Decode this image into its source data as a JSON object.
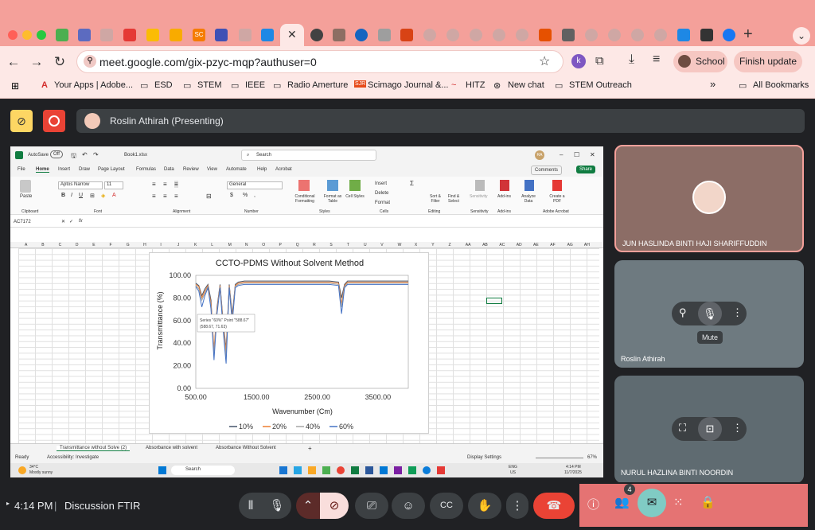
{
  "browser": {
    "url": "meet.google.com/gix-pzyc-mqp?authuser=0",
    "profile_label": "School",
    "update_label": "Finish update",
    "bookmarks": [
      "Your Apps | Adobe...",
      "ESD",
      "STEM",
      "IEEE",
      "Radio Amerture",
      "Scimago Journal &...",
      "HITZ",
      "New chat",
      "STEM Outreach"
    ],
    "all_bookmarks": "All Bookmarks",
    "tab_badges": [
      "SC"
    ]
  },
  "meet": {
    "presenter": "Roslin Athirah (Presenting)",
    "time": "4:14 PM",
    "separator": "|",
    "meeting_name": "Discussion FTIR",
    "participant_count": "4",
    "tooltip": "Mute",
    "participants": [
      {
        "name": "JUN HASLINDA BINTI HAJI SHARIFFUDDIN"
      },
      {
        "name": "Roslin Athirah"
      },
      {
        "name": "NURUL HAZLINA BINTI NOORDIN"
      }
    ],
    "accent": "#e57373"
  },
  "excel": {
    "autosave": "AutoSave",
    "toggle": "Off",
    "filename": "Book1.xlsx",
    "search": "Search",
    "avatar": "RA",
    "menu": [
      "File",
      "Home",
      "Insert",
      "Draw",
      "Page Layout",
      "Formulas",
      "Data",
      "Review",
      "View",
      "Automate",
      "Help",
      "Acrobat"
    ],
    "comments": "Comments",
    "share": "Share",
    "font": "Aptos Narrow",
    "font_size": "11",
    "number_format": "General",
    "groups": [
      "Clipboard",
      "Font",
      "Alignment",
      "Number",
      "Styles",
      "Cells",
      "Editing",
      "Sensitivity",
      "Add-ins",
      "Adobe Acrobat"
    ],
    "ribbon_buttons": [
      "Conditional Formatting",
      "Format as Table",
      "Cell Styles",
      "Insert",
      "Delete",
      "Format",
      "Sort & Filter",
      "Find & Select",
      "Sensitivity",
      "Add-ins",
      "Analyze Data",
      "Create a PDF"
    ],
    "paste": "Paste",
    "name_box": "AC7172",
    "fx": "fx",
    "columns": [
      "A",
      "B",
      "C",
      "D",
      "E",
      "F",
      "G",
      "H",
      "I",
      "J",
      "K",
      "L",
      "M",
      "N",
      "O",
      "P",
      "Q",
      "R",
      "S",
      "T",
      "U",
      "V",
      "W",
      "X",
      "Y",
      "Z",
      "AA",
      "AB",
      "AC",
      "AD",
      "AE",
      "AF",
      "AG",
      "AH"
    ],
    "sheets": [
      "Transmittance without Solve (2)",
      "Absorbance with  solvent",
      "Absorbance Without Solvent"
    ],
    "status_ready": "Ready",
    "accessibility": "Accessibility: Investigate",
    "display_settings": "Display Settings",
    "zoom": "67%",
    "weather_temp": "34°C",
    "weather_desc": "Mostly sunny",
    "taskbar_search": "Search",
    "lang": "ENG",
    "region": "US",
    "clock_time": "4:14 PM",
    "clock_date": "11/7/2025",
    "tooltip_series": "Series \"60%\" Point \"588.67\"",
    "tooltip_value": "(588.67, 71.63)"
  },
  "chart_data": {
    "type": "line",
    "title": "CCTO-PDMS Without  Solvent Method",
    "xlabel": "Wavenumber (Cm)",
    "ylabel": "Transmittance (%)",
    "xlim": [
      500,
      4000
    ],
    "ylim": [
      0,
      100
    ],
    "xticks": [
      "500.00",
      "1500.00",
      "2500.00",
      "3500.00"
    ],
    "yticks": [
      "0.00",
      "20.00",
      "40.00",
      "60.00",
      "80.00",
      "100.00"
    ],
    "legend_position": "bottom",
    "x": [
      500,
      550,
      600,
      650,
      700,
      750,
      800,
      850,
      900,
      950,
      1000,
      1050,
      1100,
      1150,
      1200,
      1300,
      1500,
      1800,
      2100,
      2400,
      2700,
      2850,
      2900,
      2950,
      3000,
      3300,
      3600,
      3900,
      4000
    ],
    "series": [
      {
        "name": "10%",
        "color": "#44546a",
        "values": [
          93,
          91,
          82,
          88,
          92,
          78,
          30,
          72,
          92,
          60,
          35,
          92,
          65,
          92,
          94,
          95,
          95,
          95,
          95,
          95,
          95,
          94,
          80,
          92,
          95,
          95,
          95,
          95,
          95
        ]
      },
      {
        "name": "20%",
        "color": "#ed7d31",
        "values": [
          92,
          90,
          80,
          86,
          91,
          75,
          35,
          70,
          91,
          58,
          33,
          91,
          62,
          91,
          93,
          94,
          94,
          94,
          94,
          94,
          94,
          93,
          75,
          91,
          94,
          94,
          94,
          94,
          94
        ]
      },
      {
        "name": "40%",
        "color": "#a5a5a5",
        "values": [
          91,
          88,
          78,
          84,
          90,
          72,
          30,
          68,
          90,
          55,
          28,
          90,
          60,
          90,
          92,
          93,
          93,
          93,
          93,
          93,
          93,
          92,
          72,
          90,
          93,
          93,
          93,
          93,
          93
        ]
      },
      {
        "name": "60%",
        "color": "#4472c4",
        "values": [
          90,
          86,
          72,
          82,
          89,
          70,
          25,
          66,
          89,
          52,
          22,
          89,
          58,
          89,
          91,
          92,
          92,
          92,
          92,
          92,
          92,
          91,
          66,
          89,
          92,
          92,
          92,
          92,
          92
        ]
      }
    ]
  }
}
